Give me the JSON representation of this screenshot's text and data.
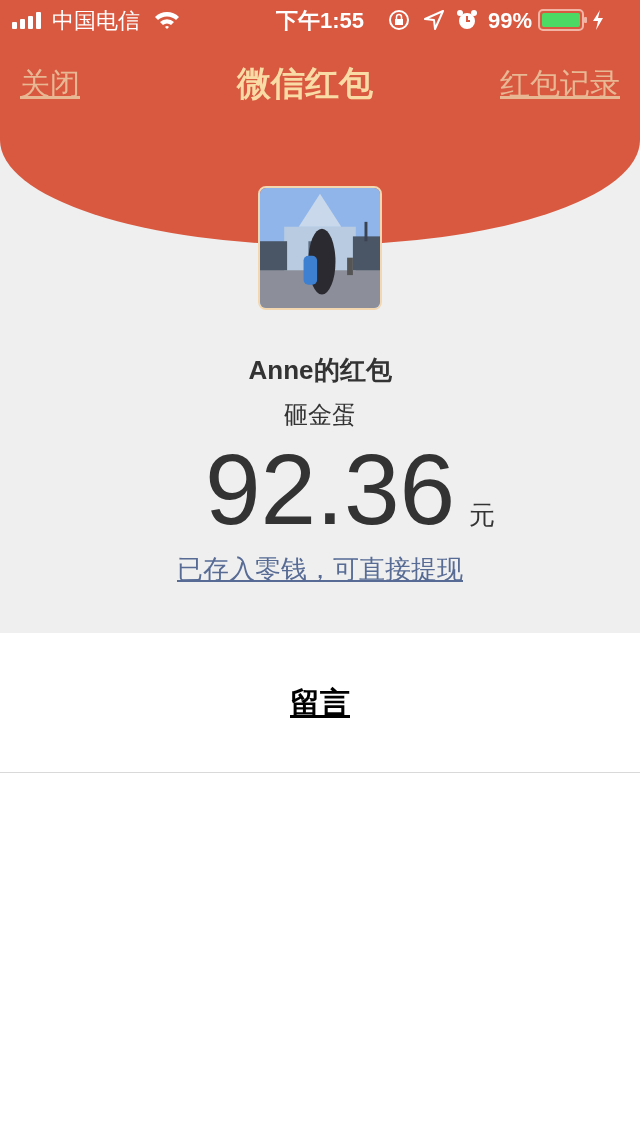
{
  "status_bar": {
    "carrier": "中国电信",
    "time": "下午1:55",
    "battery": "99%"
  },
  "header": {
    "close": "关闭",
    "title": "微信红包",
    "records": "红包记录"
  },
  "envelope": {
    "sender": "Anne的红包",
    "greeting": "砸金蛋",
    "amount": "92.36",
    "currency": "元",
    "note_link": "已存入零钱，可直接提现"
  },
  "message_button": "留言"
}
